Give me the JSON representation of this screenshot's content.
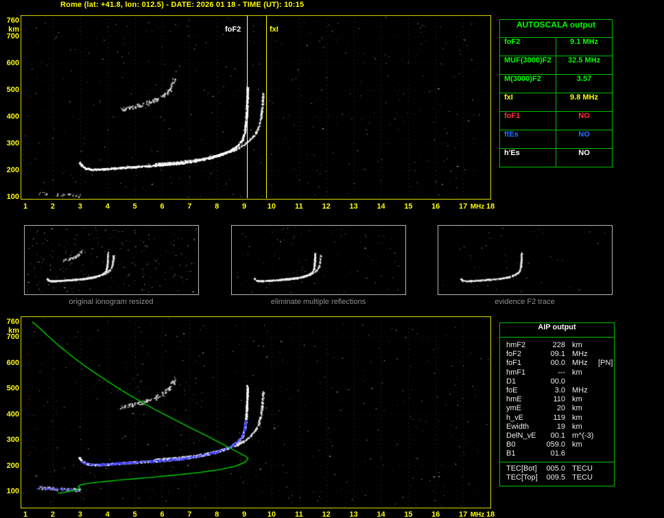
{
  "title": "Rome (lat: +41.8, lon: 012.5) - DATE: 2026 01 18 - TIME (UT): 10:15",
  "colors": {
    "green": "#00ff00",
    "yellow": "#ffff00",
    "red": "#ff3030",
    "blue": "#2b6fff",
    "white": "#ffffff",
    "gray": "#8f8f8f"
  },
  "top_plot": {
    "y_ticks": [
      "760",
      "700",
      "600",
      "500",
      "400",
      "300",
      "200",
      "100"
    ],
    "y_unit": "km",
    "x_ticks": [
      "1",
      "2",
      "3",
      "4",
      "5",
      "6",
      "7",
      "8",
      "9",
      "10",
      "11",
      "12",
      "13",
      "14",
      "15",
      "16",
      "17",
      "18"
    ],
    "x_unit": "MHz",
    "markers": {
      "foF2": {
        "label": "foF2",
        "mhz": 9.1,
        "color": "white"
      },
      "fxI": {
        "label": "fxI",
        "mhz": 9.8,
        "color": "yellow"
      }
    }
  },
  "autoscala": {
    "title": "AUTOSCALA output",
    "rows": [
      {
        "param": "foF2",
        "value": "9.1 MHz",
        "color": "green"
      },
      {
        "param": "MUF(3000)F2",
        "value": "32.5 MHz",
        "color": "green"
      },
      {
        "param": "M(3000)F2",
        "value": "3.57",
        "color": "green"
      },
      {
        "param": "fxI",
        "value": "9.8 MHz",
        "color": "yellow"
      },
      {
        "param": "foF1",
        "value": "NO",
        "color": "red"
      },
      {
        "param": "ftEs",
        "value": "NO",
        "color": "blue"
      },
      {
        "param": "h'Es",
        "value": "NO",
        "color": "white"
      }
    ]
  },
  "thumbnails": {
    "items": [
      {
        "caption": "original ionogram resized"
      },
      {
        "caption": "eliminate multiple reflections"
      },
      {
        "caption": "evidence F2 trace"
      }
    ]
  },
  "bottom_plot": {
    "y_ticks": [
      "760",
      "700",
      "600",
      "500",
      "400",
      "300",
      "200",
      "100"
    ],
    "y_unit": "km",
    "x_ticks": [
      "1",
      "2",
      "3",
      "4",
      "5",
      "6",
      "7",
      "8",
      "9",
      "10",
      "11",
      "12",
      "13",
      "14",
      "15",
      "16",
      "17",
      "18"
    ],
    "x_unit": "MHz"
  },
  "aip": {
    "title": "AIP output",
    "rows": [
      {
        "param": "hmF2",
        "value": "228",
        "unit": "km",
        "note": ""
      },
      {
        "param": "foF2",
        "value": "09.1",
        "unit": "MHz",
        "note": ""
      },
      {
        "param": "foF1",
        "value": "00.0",
        "unit": "MHz",
        "note": "[PN]"
      },
      {
        "param": "hmF1",
        "value": "---",
        "unit": "km",
        "note": ""
      },
      {
        "param": "D1",
        "value": "00.0",
        "unit": "",
        "note": ""
      },
      {
        "param": "foE",
        "value": "3.0",
        "unit": "MHz",
        "note": ""
      },
      {
        "param": "hmE",
        "value": "110",
        "unit": "km",
        "note": ""
      },
      {
        "param": "ymE",
        "value": "20",
        "unit": "km",
        "note": ""
      },
      {
        "param": "h_vE",
        "value": "119",
        "unit": "km",
        "note": ""
      },
      {
        "param": "Ewidth",
        "value": "19",
        "unit": "km",
        "note": ""
      },
      {
        "param": "DelN_vE",
        "value": "00.1",
        "unit": "m^(-3)",
        "note": ""
      },
      {
        "param": "B0",
        "value": "059.0",
        "unit": "km",
        "note": ""
      },
      {
        "param": "B1",
        "value": "01.6",
        "unit": "",
        "note": ""
      }
    ],
    "tec_rows": [
      {
        "param": "TEC[Bot]",
        "value": "005.0",
        "unit": "TECU",
        "note": ""
      },
      {
        "param": "TEC[Top]",
        "value": "009.5",
        "unit": "TECU",
        "note": ""
      }
    ]
  }
}
